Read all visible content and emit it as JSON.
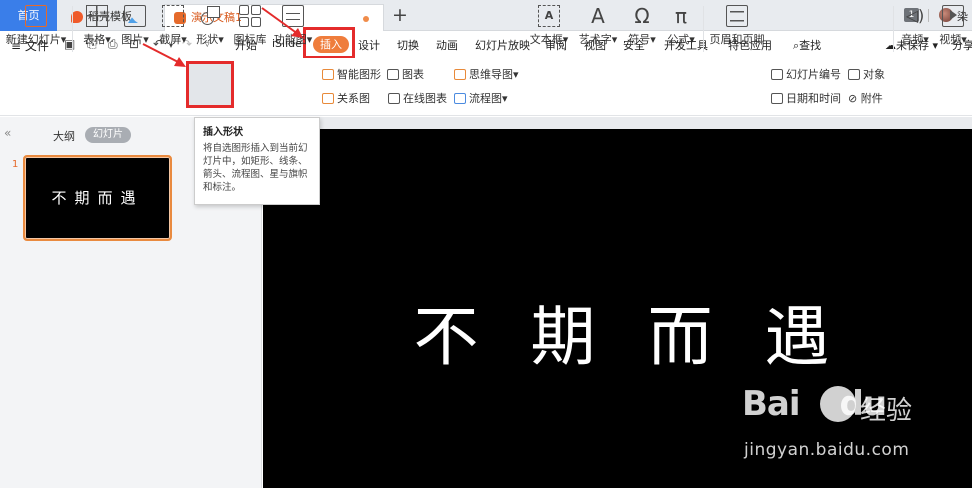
{
  "tabbar": {
    "home": "首页",
    "template_tab": "稻壳模板",
    "doc_tab": "演示文稿1",
    "new_tab": "+",
    "page_badge": "1",
    "user": "染"
  },
  "menubar": {
    "file": "文件",
    "tabs": [
      "开始",
      "iSlide",
      "插入",
      "设计",
      "切换",
      "动画",
      "幻灯片放映",
      "审阅",
      "视图",
      "安全",
      "开发工具",
      "特色应用"
    ],
    "search": "查找",
    "unsaved": "未保存",
    "share": "分享"
  },
  "ribbon": {
    "new_slide": "新建幻灯片",
    "table": "表格",
    "picture": "图片",
    "screenshot": "截屏",
    "shape": "形状",
    "icon_library": "图标库",
    "function_chart": "功能图",
    "smart_graphic": "智能图形",
    "chart": "图表",
    "relation_chart": "关系图",
    "online_chart": "在线图表",
    "mind_map": "思维导图",
    "flowchart": "流程图",
    "textbox": "文本框",
    "wordart": "艺术字",
    "symbol": "符号",
    "formula": "公式",
    "header_footer": "页眉和页脚",
    "slide_number": "幻灯片编号",
    "object": "对象",
    "datetime": "日期和时间",
    "attachment": "附件",
    "audio": "音频",
    "video": "视频"
  },
  "tooltip": {
    "title": "插入形状",
    "body": "将自选图形插入到当前幻灯片中，如矩形、线条、箭头、流程图、星与旗帜和标注。"
  },
  "leftpanel": {
    "outline_tab": "大纲",
    "slides_tab": "幻灯片",
    "slide_number": "1",
    "thumb_text": "不期而遇"
  },
  "slide": {
    "text": "不期而遇"
  },
  "watermark": {
    "brand": "Bai",
    "brand2": "du",
    "cn": "经验",
    "url": "jingyan.baidu.com"
  },
  "colors": {
    "accent_orange": "#ef7d3c",
    "highlight_red": "#e42b2b",
    "home_blue": "#3a7ee9"
  }
}
